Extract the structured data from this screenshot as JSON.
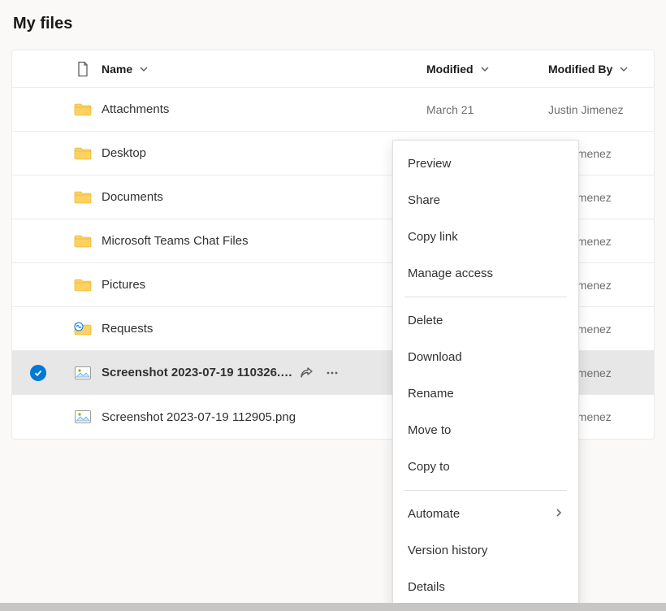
{
  "title": "My files",
  "columns": {
    "name": "Name",
    "modified": "Modified",
    "modifiedBy": "Modified By"
  },
  "rows": [
    {
      "type": "folder",
      "name": "Attachments",
      "modified": "March 21",
      "modifiedBy": "Justin Jimenez",
      "selected": false
    },
    {
      "type": "folder",
      "name": "Desktop",
      "modified": "",
      "modifiedBy": "stin Jimenez",
      "selected": false
    },
    {
      "type": "folder",
      "name": "Documents",
      "modified": "",
      "modifiedBy": "stin Jimenez",
      "selected": false
    },
    {
      "type": "folder",
      "name": "Microsoft Teams Chat Files",
      "modified": "",
      "modifiedBy": "stin Jimenez",
      "selected": false
    },
    {
      "type": "folder",
      "name": "Pictures",
      "modified": "",
      "modifiedBy": "stin Jimenez",
      "selected": false
    },
    {
      "type": "linked-folder",
      "name": "Requests",
      "modified": "",
      "modifiedBy": "stin Jimenez",
      "selected": false
    },
    {
      "type": "image",
      "name": "Screenshot 2023-07-19 110326.…",
      "modified": "",
      "modifiedBy": "stin Jimenez",
      "selected": true
    },
    {
      "type": "image",
      "name": "Screenshot 2023-07-19 112905.png",
      "modified": "",
      "modifiedBy": "stin Jimenez",
      "selected": false
    }
  ],
  "contextMenu": {
    "groups": [
      [
        "Preview",
        "Share",
        "Copy link",
        "Manage access"
      ],
      [
        "Delete",
        "Download",
        "Rename",
        "Move to",
        "Copy to"
      ],
      [
        "Automate",
        "Version history",
        "Details"
      ]
    ],
    "submenuItems": [
      "Automate"
    ]
  }
}
